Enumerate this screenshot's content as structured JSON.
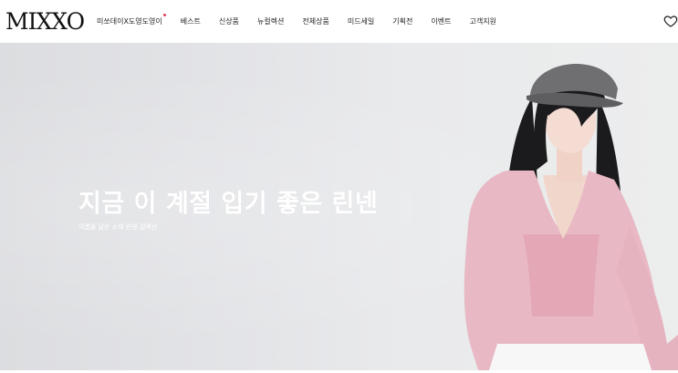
{
  "brand": {
    "logo": "MIXXO"
  },
  "nav": {
    "items": [
      {
        "label": "미쏘데이X도영도영이",
        "badge": true
      },
      {
        "label": "베스트"
      },
      {
        "label": "신상품"
      },
      {
        "label": "뉴컬렉션"
      },
      {
        "label": "전체상품"
      },
      {
        "label": "미드세일"
      },
      {
        "label": "기획전"
      },
      {
        "label": "이벤트"
      },
      {
        "label": "고객지원"
      }
    ]
  },
  "header_icons": {
    "wishlist": "heart-icon"
  },
  "hero": {
    "title": "지금 이 계절 입기 좋은 린넨",
    "subtitle": "여름을 닮은 소재 린넨 컬렉션"
  },
  "colors": {
    "badge": "#e83a5a",
    "text": "#222222",
    "hero_text": "#ffffff"
  }
}
